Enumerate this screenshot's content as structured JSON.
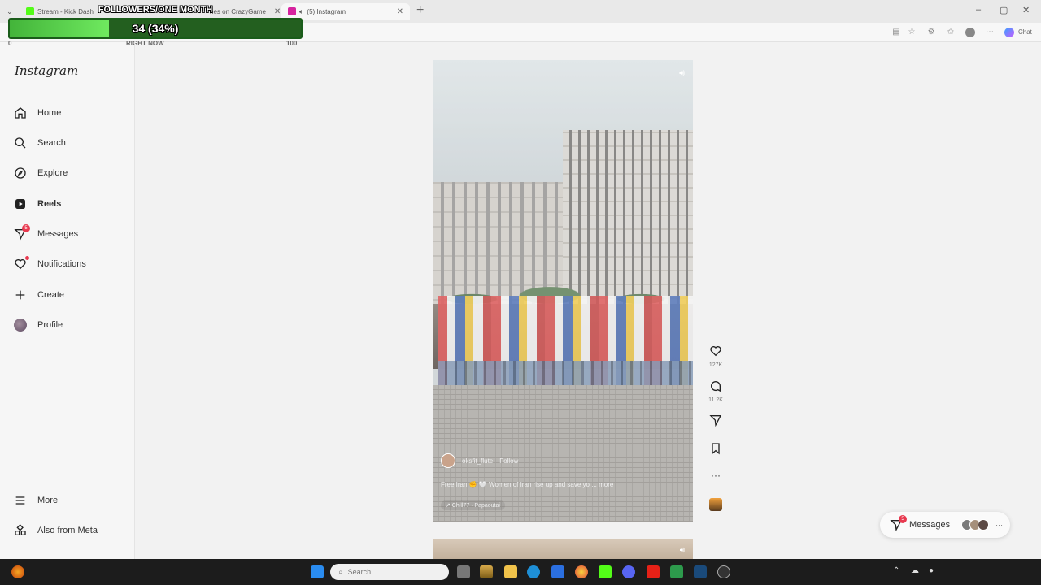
{
  "browser": {
    "tabs": [
      {
        "label": "Stream - Kick Dash",
        "color": "#53fc18"
      },
      {
        "label": "nes on CrazyGame",
        "color": "#7b4fd6"
      },
      {
        "label": "(5) Instagram",
        "color": "#d6249f"
      }
    ],
    "chat_label": "Chat"
  },
  "overlay": {
    "title": "FOLLOWERS/ONE MONTH",
    "value_text": "34 (34%)",
    "progress": 0.34,
    "min_label": "0",
    "now_label": "RIGHT NOW",
    "max_label": "100"
  },
  "sidebar": {
    "logo": "Instagram",
    "items": [
      {
        "label": "Home",
        "icon": "home-icon"
      },
      {
        "label": "Search",
        "icon": "search-icon"
      },
      {
        "label": "Explore",
        "icon": "compass-icon"
      },
      {
        "label": "Reels",
        "icon": "reels-icon"
      },
      {
        "label": "Messages",
        "icon": "messenger-icon",
        "badge": "5"
      },
      {
        "label": "Notifications",
        "icon": "heart-icon"
      },
      {
        "label": "Create",
        "icon": "plus-icon"
      },
      {
        "label": "Profile",
        "icon": "avatar"
      },
      {
        "label": "More",
        "icon": "hamburger-icon"
      },
      {
        "label": "Also from Meta",
        "icon": "meta-apps-icon"
      }
    ]
  },
  "reel": {
    "author": "oksfit_flute",
    "follow": "Follow",
    "caption": "Free Iran ✊ 🤍 Women of Iran rise up and save yo ... more",
    "audio": "↗ Chill77 · Papaoutai",
    "likes": "127K",
    "comments": "11.2K"
  },
  "messages_pill": {
    "label": "Messages",
    "badge": "5"
  },
  "taskbar": {
    "search_placeholder": "Search"
  },
  "colors": {
    "accent_red": "#e8394f",
    "progress_green": "#43b43a"
  }
}
